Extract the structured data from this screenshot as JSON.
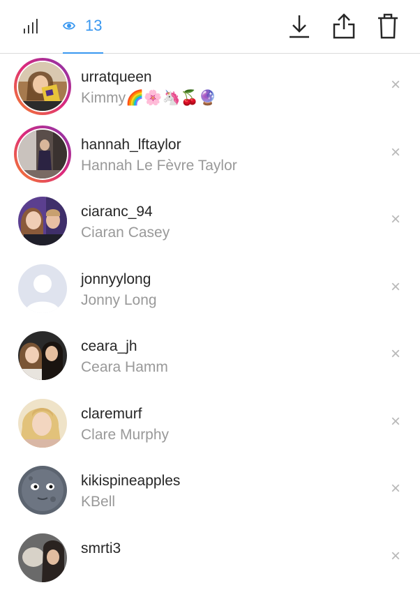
{
  "header": {
    "viewer_count": "13",
    "icons": {
      "stats": "bar-chart-icon",
      "viewers": "eye-icon",
      "download": "download-icon",
      "share": "share-icon",
      "delete": "trash-icon"
    },
    "accent_color": "#3897f0"
  },
  "viewers": [
    {
      "username": "urratqueen",
      "full_name": "Kimmy🌈🌸🦄🍒🔮",
      "has_story_ring": true
    },
    {
      "username": "hannah_lftaylor",
      "full_name": "Hannah Le Fèvre Taylor",
      "has_story_ring": true
    },
    {
      "username": "ciaranc_94",
      "full_name": "Ciaran Casey",
      "has_story_ring": false
    },
    {
      "username": "jonnyylong",
      "full_name": "Jonny Long",
      "has_story_ring": false
    },
    {
      "username": "ceara_jh",
      "full_name": "Ceara Hamm",
      "has_story_ring": false
    },
    {
      "username": "claremurf",
      "full_name": "Clare Murphy",
      "has_story_ring": false
    },
    {
      "username": "kikispineapples",
      "full_name": "KBell",
      "has_story_ring": false
    },
    {
      "username": "smrti3",
      "full_name": "",
      "has_story_ring": false
    }
  ],
  "dismiss_glyph": "×"
}
